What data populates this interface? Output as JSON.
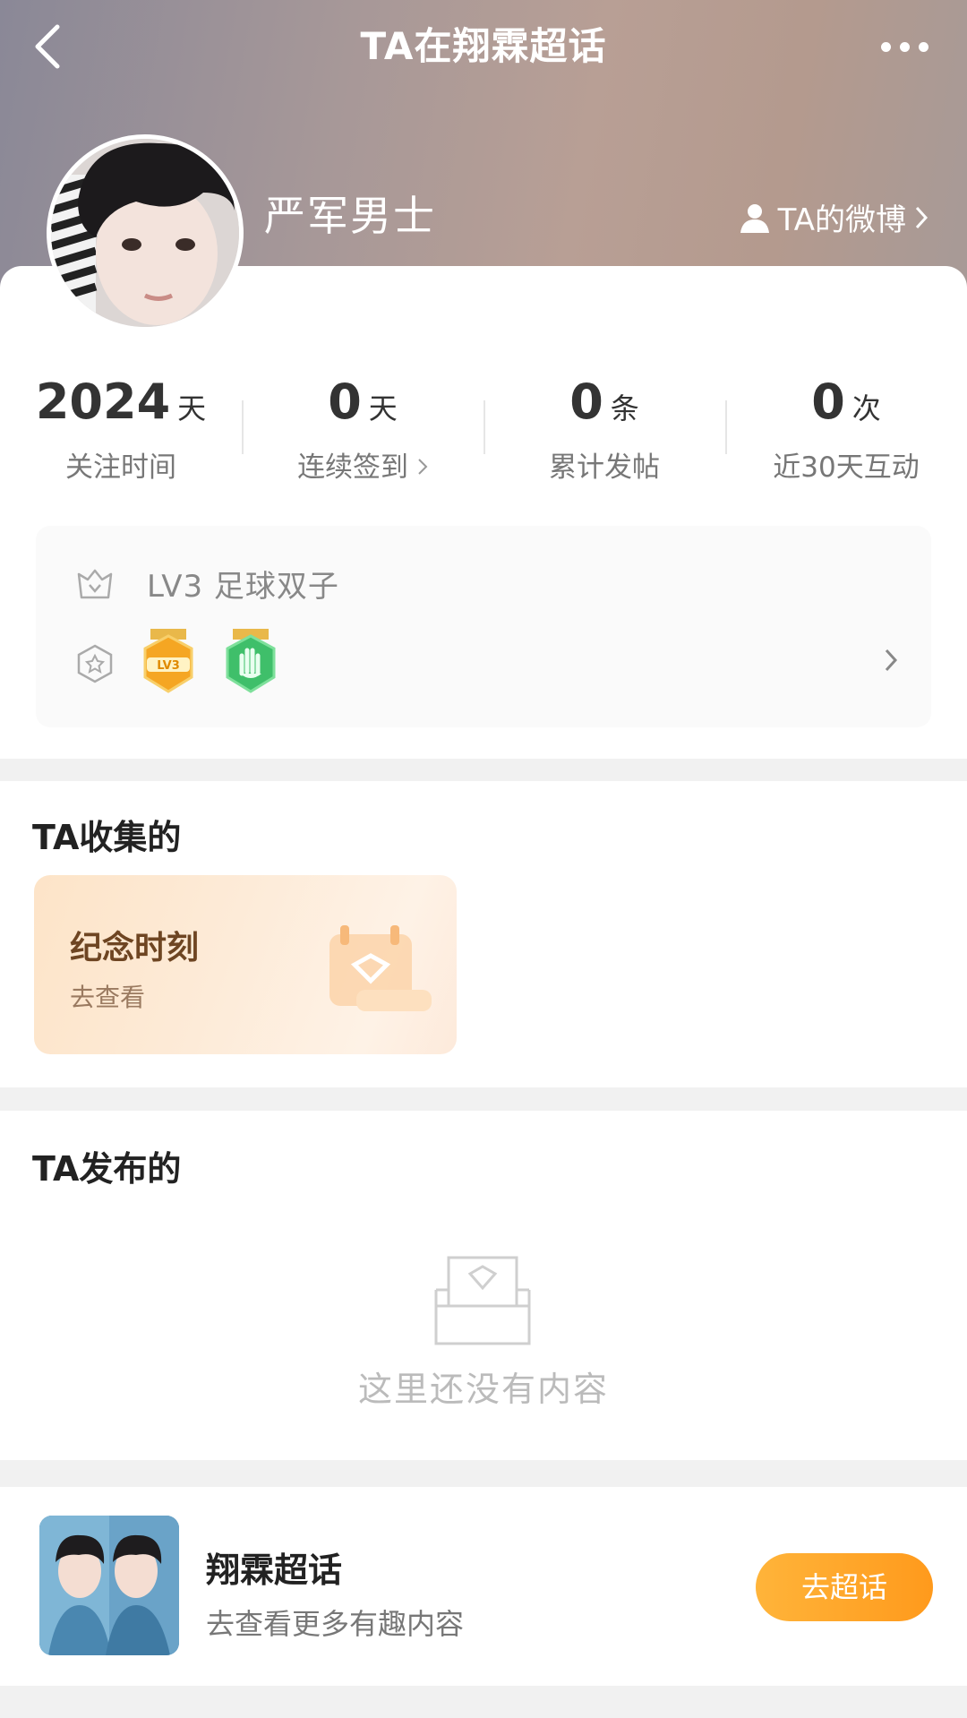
{
  "header": {
    "title": "TA在翔霖超话",
    "back_icon": "chevron-left-icon",
    "more_icon": "more-dots-icon"
  },
  "profile": {
    "username": "严军男士",
    "weibo_link": "TA的微博"
  },
  "stats": [
    {
      "value": "2024",
      "unit": "天",
      "label": "关注时间"
    },
    {
      "value": "0",
      "unit": "天",
      "label": "连续签到",
      "has_chevron": true
    },
    {
      "value": "0",
      "unit": "条",
      "label": "累计发帖"
    },
    {
      "value": "0",
      "unit": "次",
      "label": "近30天互动"
    }
  ],
  "level": {
    "text": "LV3 足球双子",
    "badge_lv_label": "LV3"
  },
  "collected": {
    "title": "TA收集的",
    "card_title": "纪念时刻",
    "card_sub": "去查看"
  },
  "posted": {
    "title": "TA发布的",
    "empty_text": "这里还没有内容"
  },
  "banner": {
    "title": "翔霖超话",
    "subtitle": "去查看更多有趣内容",
    "button": "去超话"
  },
  "colors": {
    "accent_orange": "#ff9a1c",
    "badge_gold": "#f5a623",
    "badge_green": "#3fbf6a"
  }
}
